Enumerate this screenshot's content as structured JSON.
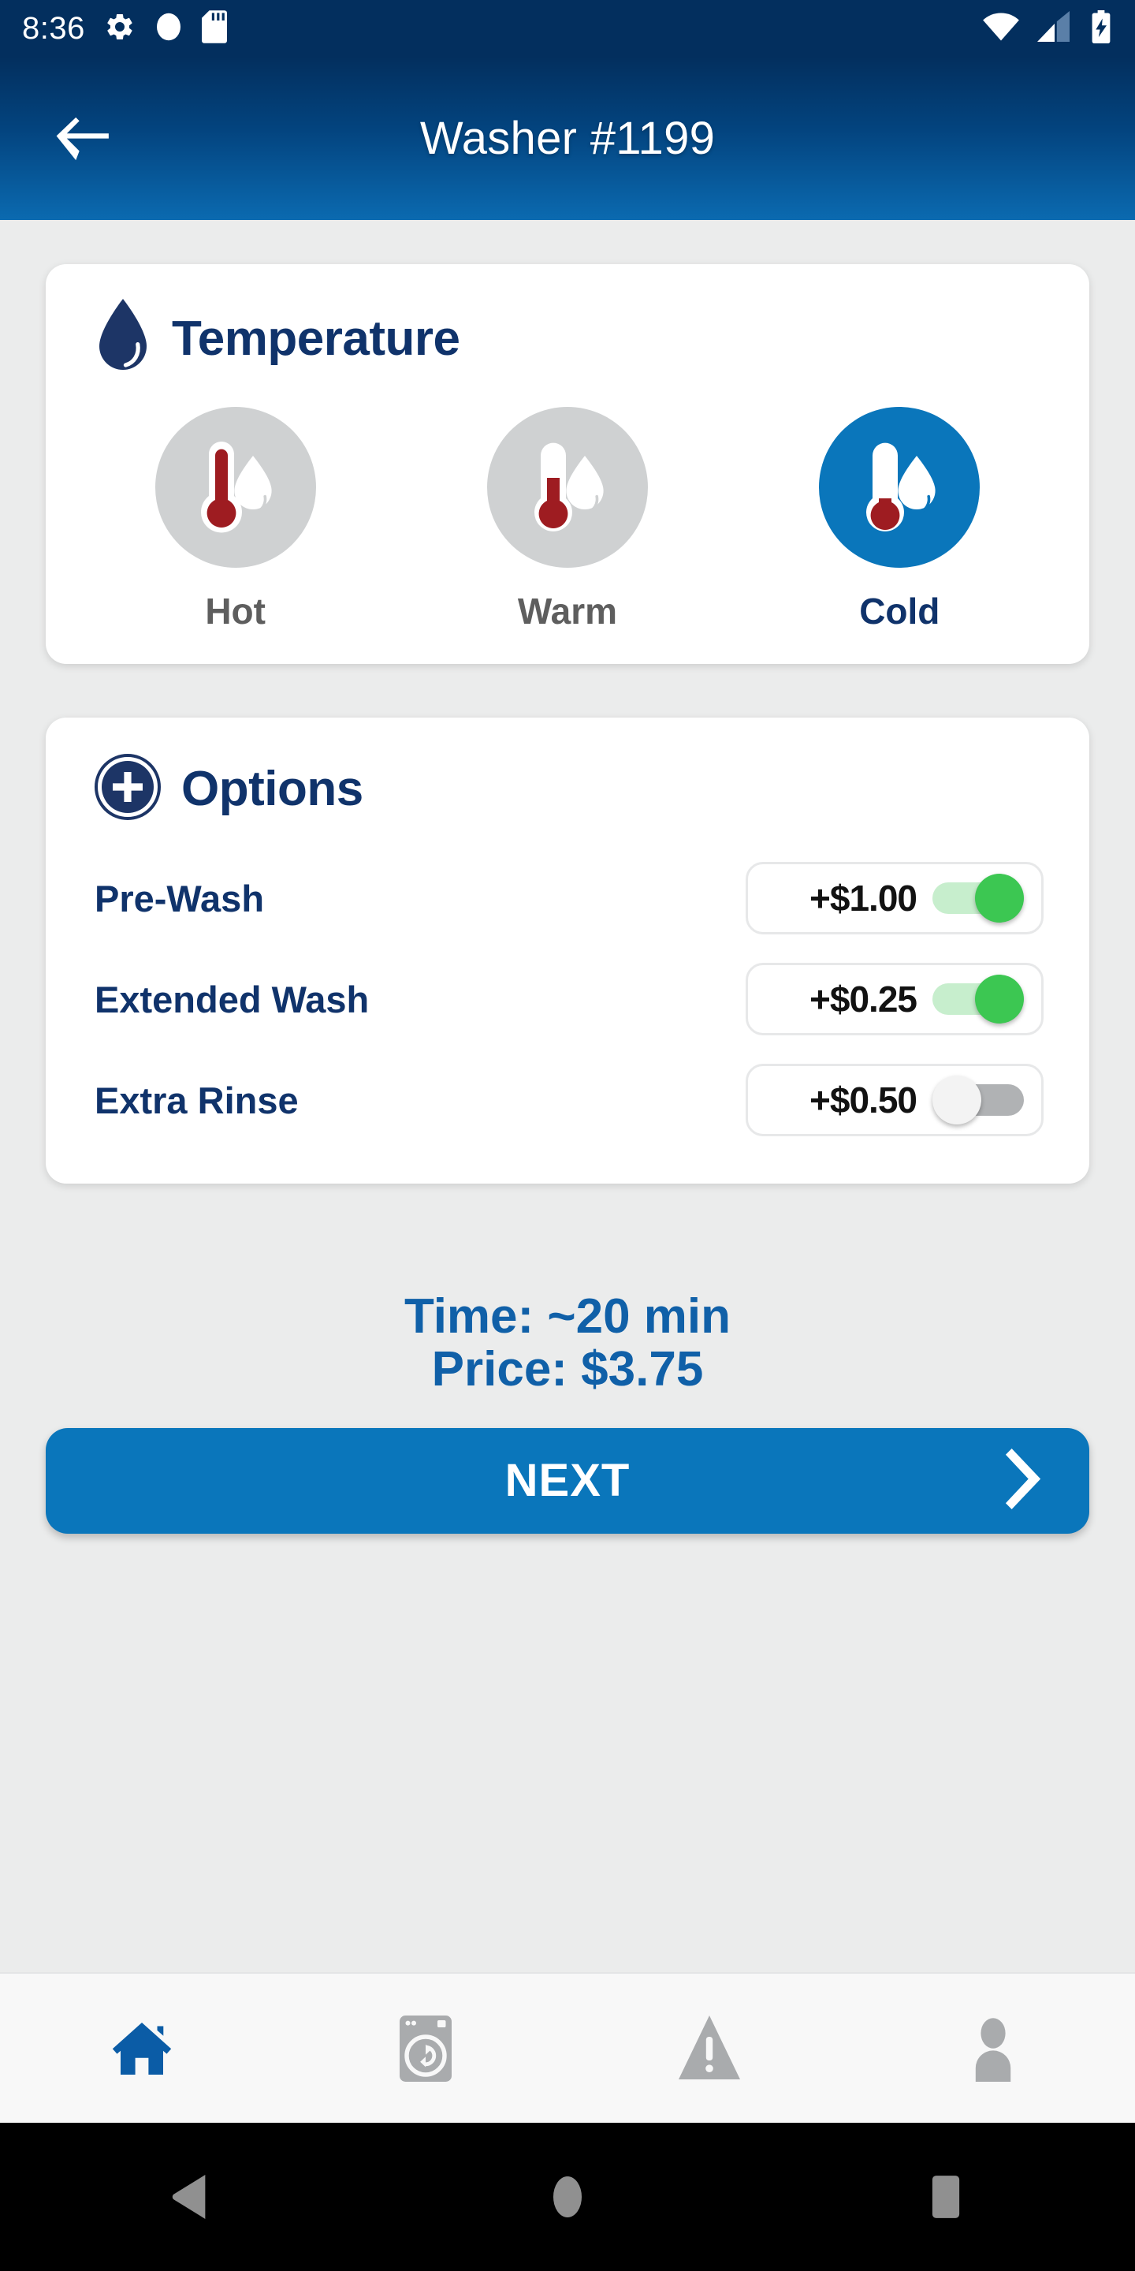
{
  "status_bar": {
    "time": "8:36",
    "left_icons": [
      "gear-icon",
      "circle-icon",
      "sd-card-icon"
    ],
    "right_icons": [
      "wifi-icon",
      "cellular-signal-icon",
      "battery-charging-icon"
    ],
    "background_color": "#032f5e"
  },
  "app_bar": {
    "back_label": "back-arrow",
    "title": "Washer #1199",
    "gradient_from": "#032f5e",
    "gradient_to": "#0b6ab0"
  },
  "temperature": {
    "icon": "water-drop-icon",
    "title": "Temperature",
    "selected": "Cold",
    "options": [
      {
        "label": "Hot",
        "selected": false,
        "fill_ratio": 1.0
      },
      {
        "label": "Warm",
        "selected": false,
        "fill_ratio": 0.45
      },
      {
        "label": "Cold",
        "selected": true,
        "fill_ratio": 0.1
      }
    ],
    "selected_color": "#0a76bb",
    "unselected_color": "#cfd1d2",
    "mercury_color": "#9e1c21"
  },
  "options": {
    "icon": "plus-circle-icon",
    "title": "Options",
    "items": [
      {
        "name": "Pre-Wash",
        "price": "+$1.00",
        "enabled": true
      },
      {
        "name": "Extended Wash",
        "price": "+$0.25",
        "enabled": true
      },
      {
        "name": "Extra Rinse",
        "price": "+$0.50",
        "enabled": false
      }
    ],
    "toggle_on_color": "#3cc752",
    "toggle_off_color": "#b0b2b4"
  },
  "summary": {
    "time_line": "Time: ~20 min",
    "price_line": "Price: $3.75",
    "text_color": "#1060a8"
  },
  "next_button": {
    "label": "NEXT",
    "icon": "chevron-right-icon",
    "color": "#0a76bb"
  },
  "bottom_nav": {
    "items": [
      {
        "icon": "home-icon",
        "active": true
      },
      {
        "icon": "washer-icon",
        "active": false
      },
      {
        "icon": "warning-icon",
        "active": false
      },
      {
        "icon": "person-icon",
        "active": false
      }
    ],
    "active_color": "#0b5ca6",
    "inactive_color": "#a9abad"
  },
  "android_nav": {
    "items": [
      "back-triangle-icon",
      "home-circle-icon",
      "recents-square-icon"
    ],
    "icon_color": "#909090"
  }
}
